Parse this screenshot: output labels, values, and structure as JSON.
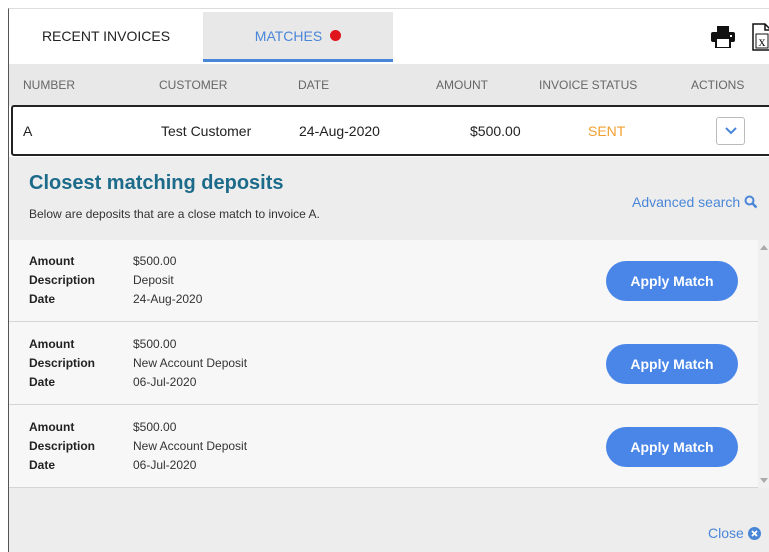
{
  "tabs": [
    {
      "label": "RECENT INVOICES"
    },
    {
      "label": "MATCHES"
    }
  ],
  "toolbar": {
    "print_icon": "printer-icon",
    "export_icon": "excel-export-icon"
  },
  "table": {
    "headers": [
      "NUMBER",
      "CUSTOMER",
      "DATE",
      "AMOUNT",
      "INVOICE STATUS",
      "ACTIONS"
    ],
    "row": {
      "number": "A",
      "customer": "Test Customer",
      "date": "24-Aug-2020",
      "amount": "$500.00",
      "status": "SENT"
    }
  },
  "matches": {
    "title": "Closest matching deposits",
    "subtitle": "Below are deposits that are a close match to invoice A.",
    "advanced_search": "Advanced search",
    "labels": {
      "amount": "Amount",
      "description": "Description",
      "date": "Date"
    },
    "items": [
      {
        "amount": "$500.00",
        "description": "Deposit",
        "date": "24-Aug-2020",
        "button": "Apply Match"
      },
      {
        "amount": "$500.00",
        "description": "New Account Deposit",
        "date": "06-Jul-2020",
        "button": "Apply Match"
      },
      {
        "amount": "$500.00",
        "description": "New Account Deposit",
        "date": "06-Jul-2020",
        "button": "Apply Match"
      }
    ],
    "close": "Close"
  },
  "colors": {
    "accent": "#4a86d8",
    "title": "#1d6b8a",
    "status_sent": "#f0a030",
    "notification": "#e0141c"
  }
}
